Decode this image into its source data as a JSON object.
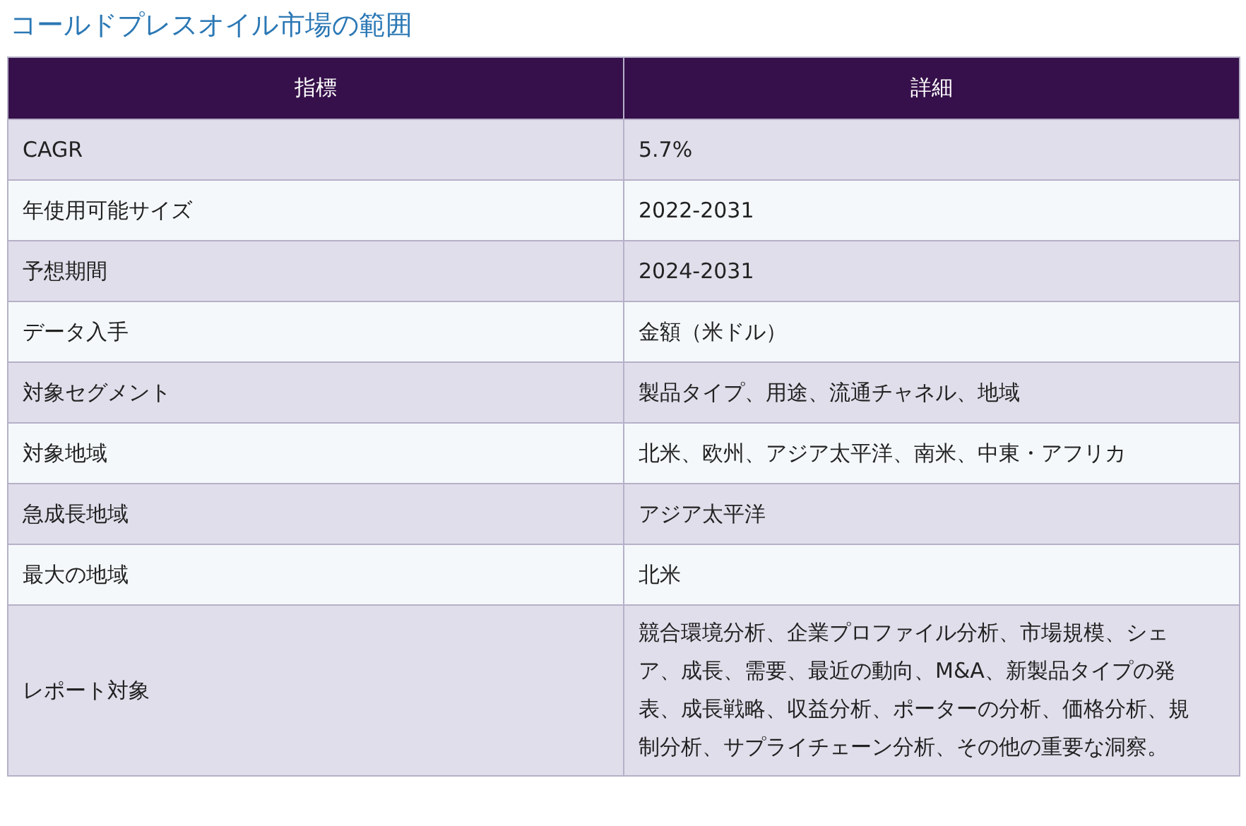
{
  "title": "コールドプレスオイル市場の範囲",
  "table": {
    "columns": [
      "指標",
      "詳細"
    ],
    "rows": [
      {
        "metric": "CAGR",
        "detail": "5.7%"
      },
      {
        "metric": "年使用可能サイズ",
        "detail": "2022-2031"
      },
      {
        "metric": "予想期間",
        "detail": "2024-2031"
      },
      {
        "metric": "データ入手",
        "detail": "金額（米ドル）"
      },
      {
        "metric": "対象セグメント",
        "detail": "製品タイプ、用途、流通チャネル、地域"
      },
      {
        "metric": "対象地域",
        "detail": "北米、欧州、アジア太平洋、南米、中東・アフリカ"
      },
      {
        "metric": "急成長地域",
        "detail": "アジア太平洋"
      },
      {
        "metric": "最大の地域",
        "detail": "北米"
      },
      {
        "metric": "レポート対象",
        "detail": "競合環境分析、企業プロファイル分析、市場規模、シェア、成長、需要、最近の動向、M&A、新製品タイプの発表、成長戦略、収益分析、ポーターの分析、価格分析、規制分析、サプライチェーン分析、その他の重要な洞察。"
      }
    ]
  }
}
